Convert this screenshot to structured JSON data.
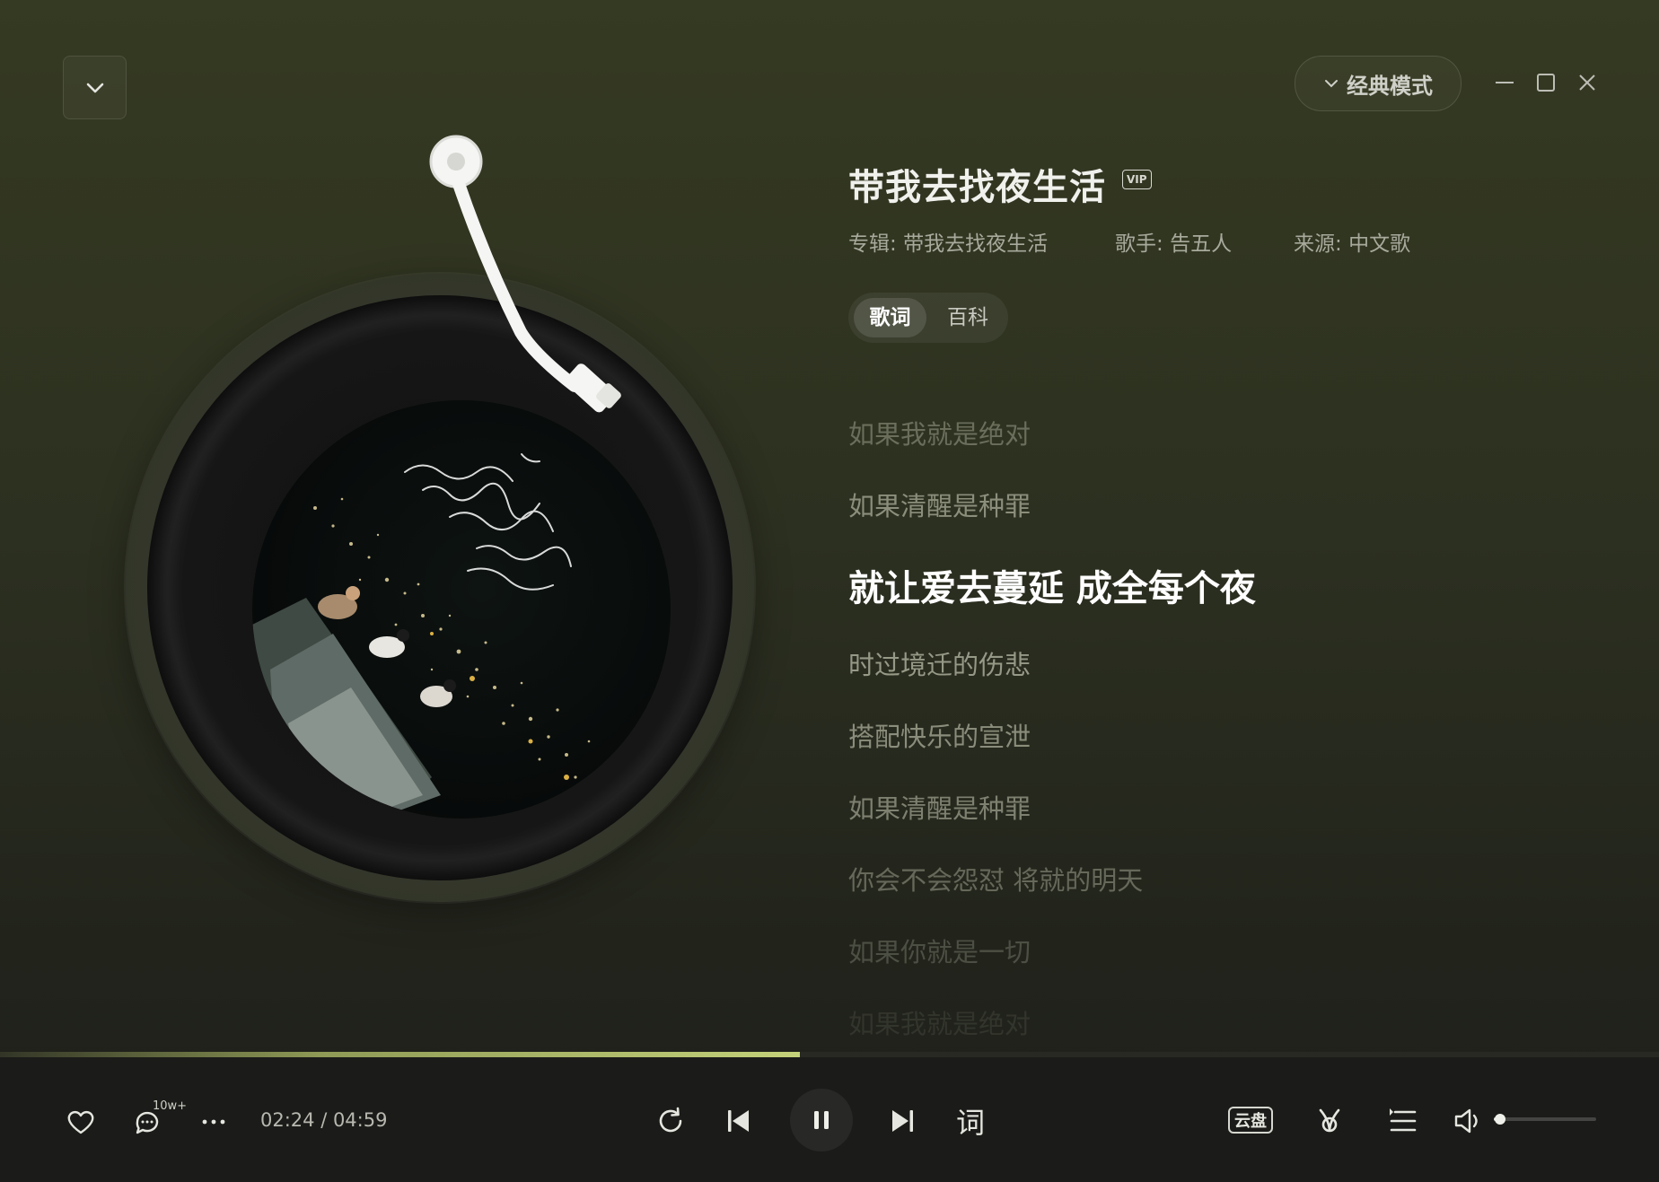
{
  "header": {
    "mode_label": "经典模式"
  },
  "song": {
    "title": "带我去找夜生活",
    "badge": "VIP",
    "album_label": "专辑:",
    "album": "带我去找夜生活",
    "artist_label": "歌手:",
    "artist": "告五人",
    "source_label": "来源:",
    "source": "中文歌"
  },
  "tabs": [
    {
      "label": "歌词",
      "active": true
    },
    {
      "label": "百科",
      "active": false
    }
  ],
  "lyrics": {
    "lines": [
      {
        "text": "如果我就是绝对"
      },
      {
        "text": "如果清醒是种罪"
      },
      {
        "text": "就让爱去蔓延 成全每个夜",
        "active": true
      },
      {
        "text": "时过境迁的伤悲"
      },
      {
        "text": "搭配快乐的宣泄"
      },
      {
        "text": "如果清醒是种罪"
      },
      {
        "text": "你会不会怨怼 将就的明天"
      },
      {
        "text": "如果你就是一切"
      },
      {
        "text": "如果我就是绝对"
      }
    ]
  },
  "player": {
    "elapsed": "02:24",
    "duration": "04:59",
    "time_text": "02:24 / 04:59",
    "progress_fraction": 0.482,
    "comment_count": "10w+",
    "lyrics_button": "词",
    "cloud_label": "云盘",
    "volume_fraction": 0.06
  },
  "colors": {
    "progress_accent": "#c5d27a",
    "background_top": "#353a22",
    "bottom_bar": "#1b1b19"
  }
}
